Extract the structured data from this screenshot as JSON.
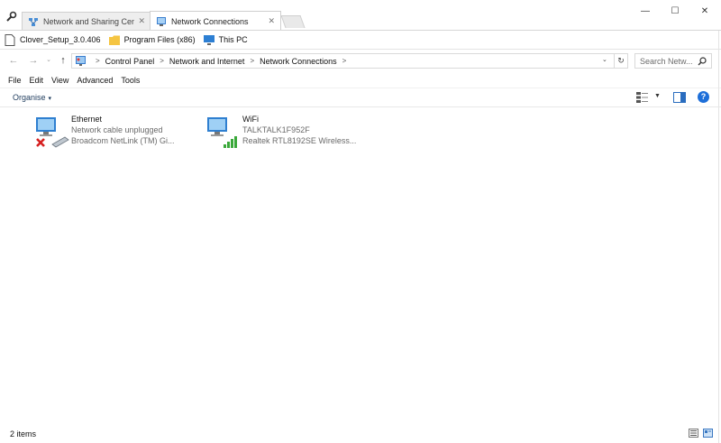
{
  "tabs": [
    {
      "label": "Network and Sharing Cent",
      "active": false
    },
    {
      "label": "Network Connections",
      "active": true
    }
  ],
  "window_controls": {
    "minimize": "—",
    "maximize": "☐",
    "close": "✕"
  },
  "bookmarks": [
    {
      "label": "Clover_Setup_3.0.406",
      "icon": "file-icon"
    },
    {
      "label": "Program Files (x86)",
      "icon": "folder-icon"
    },
    {
      "label": "This PC",
      "icon": "monitor-icon"
    }
  ],
  "nav": {
    "back": "←",
    "forward": "→",
    "recent": "⌄",
    "up": "↑"
  },
  "address": {
    "crumbs": [
      "Control Panel",
      "Network and Internet",
      "Network Connections"
    ],
    "dropdown": "⌄",
    "refresh": "↻"
  },
  "search": {
    "placeholder": "Search Netw..."
  },
  "menu": [
    "File",
    "Edit",
    "View",
    "Advanced",
    "Tools"
  ],
  "command_bar": {
    "organise": "Organise",
    "caret": "▾",
    "help": "?"
  },
  "connections": [
    {
      "name": "Ethernet",
      "status": "Network cable unplugged",
      "device": "Broadcom NetLink (TM) Gi...",
      "icon": "ethernet-disconnected-icon"
    },
    {
      "name": "WiFi",
      "status": "TALKTALK1F952F",
      "device": "Realtek RTL8192SE Wireless...",
      "icon": "wifi-connected-icon"
    }
  ],
  "status_bar": {
    "item_count": "2 items"
  },
  "colors": {
    "accent": "#1e6fd9",
    "link": "#1e3b5c",
    "error": "#d61f1f",
    "signal": "#3aa83a"
  }
}
